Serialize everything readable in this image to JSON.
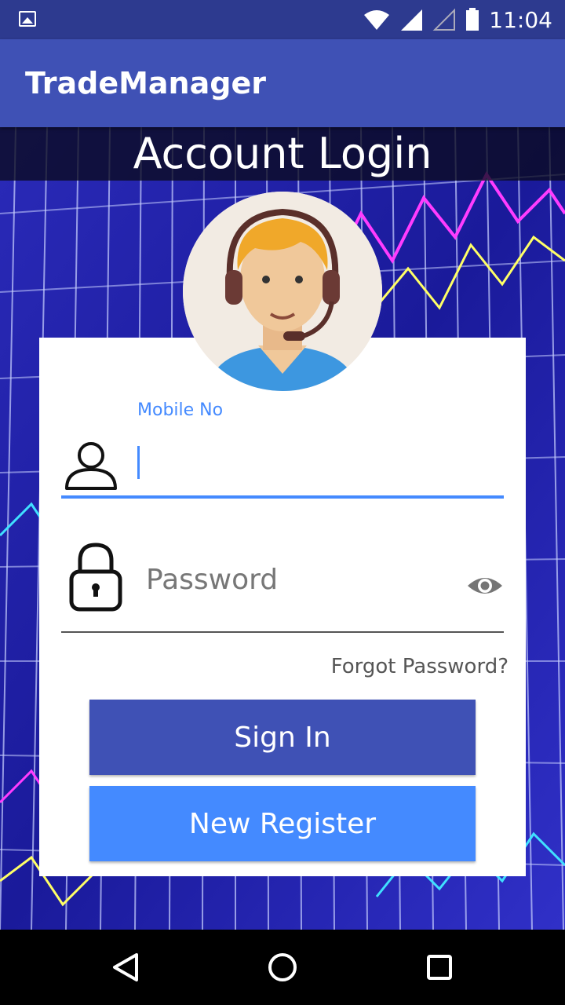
{
  "status_bar": {
    "time": "11:04",
    "icons": [
      "gallery-icon",
      "wifi-icon",
      "signal-icon",
      "signal-empty-icon",
      "battery-icon"
    ]
  },
  "app_bar": {
    "title": "TradeManager"
  },
  "login": {
    "heading": "Account Login",
    "mobile_label": "Mobile No",
    "mobile_value": "",
    "password_placeholder": "Password",
    "forgot_password": "Forgot Password?",
    "sign_in": "Sign In",
    "new_register": "New Register"
  },
  "nav_bar": {
    "icons": [
      "back-icon",
      "home-icon",
      "recents-icon"
    ]
  },
  "colors": {
    "status_bar": "#2d3a8f",
    "app_bar": "#3f51b5",
    "accent": "#448aff",
    "sign_in_button": "#3f51b5",
    "register_button": "#448aff"
  }
}
